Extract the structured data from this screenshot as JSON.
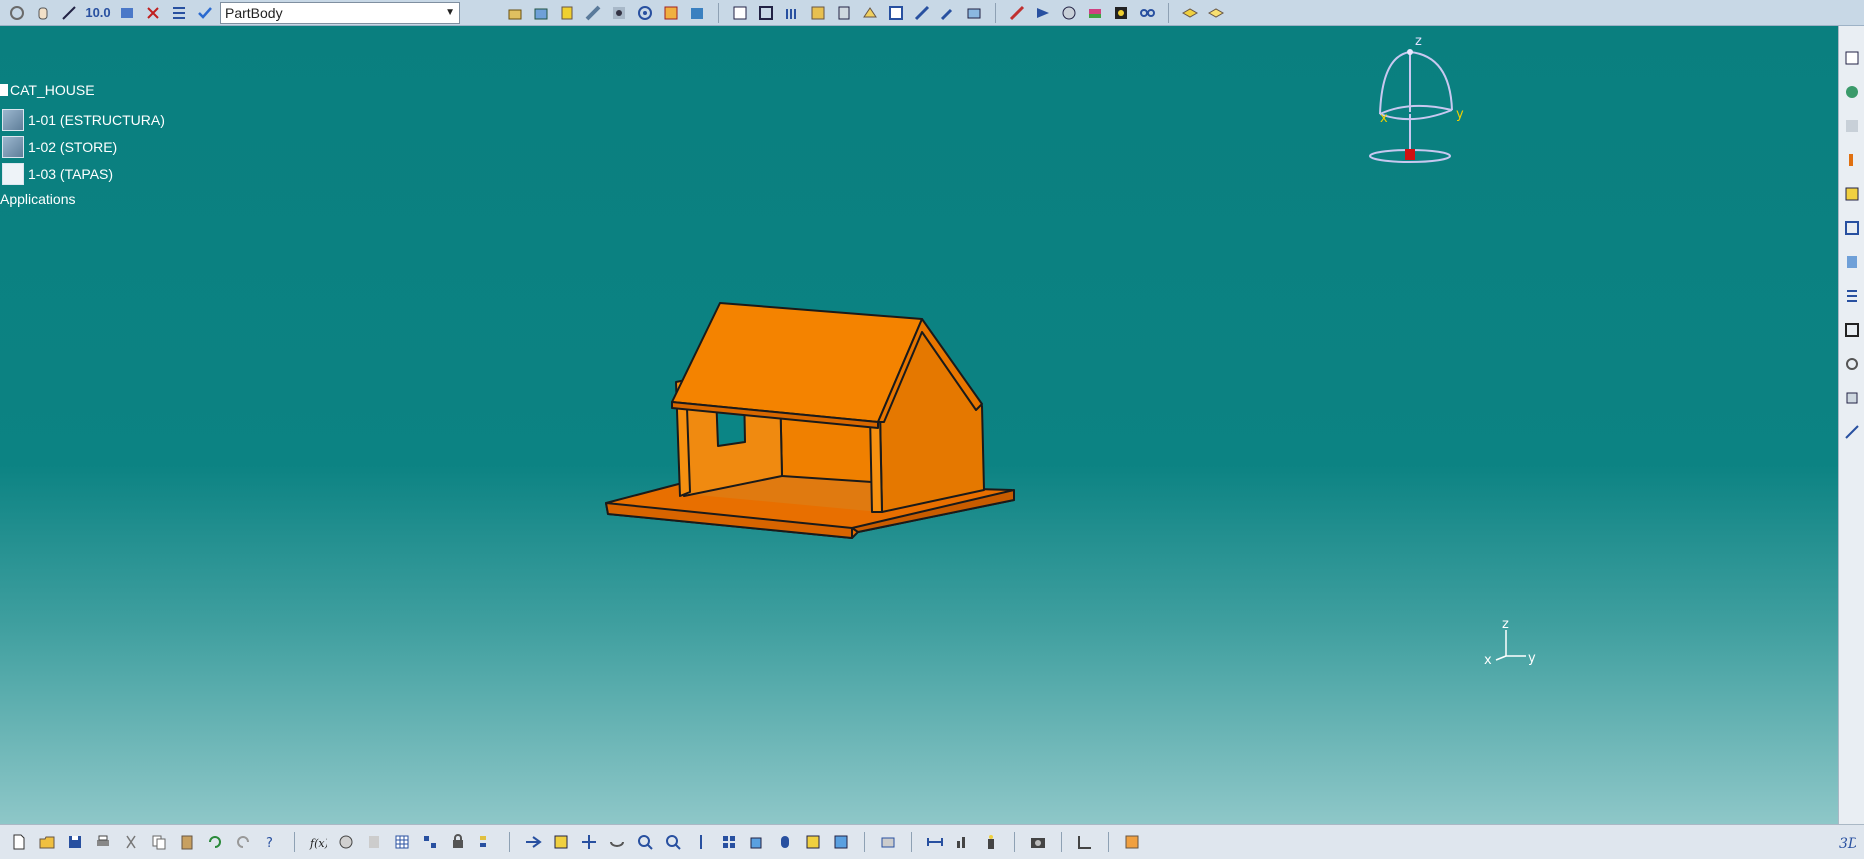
{
  "top_toolbar": {
    "precision_value": "10.0",
    "current_body": "PartBody",
    "icons": [
      "rotate-icon",
      "hand-icon",
      "measure-icon",
      "view-mode-icon",
      "cut-icon",
      "tree-list-icon",
      "check-icon",
      "pad-icon",
      "pocket-icon",
      "shaft-icon",
      "rib-icon",
      "hole-icon",
      "target-icon",
      "boolean-icon",
      "draft-icon",
      "edit-sketch-icon",
      "box-icon",
      "fillet-icon",
      "chamfer-icon",
      "shell-icon",
      "thickness-icon",
      "thread-icon",
      "remove-face-icon",
      "translate-icon",
      "mirror-icon",
      "pattern-icon",
      "scale-icon",
      "measure-item-icon",
      "publish-icon",
      "analysis-icon",
      "apply-material-icon",
      "render-icon",
      "constraint-icon",
      "layer-icon",
      "filter-icon"
    ]
  },
  "tree": {
    "root": "CAT_HOUSE",
    "items": [
      {
        "label": "1-01 (ESTRUCTURA)"
      },
      {
        "label": "1-02 (STORE)"
      },
      {
        "label": "1-03 (TAPAS)"
      }
    ],
    "applications": "Applications"
  },
  "compass": {
    "x_label": "x",
    "y_label": "y",
    "z_label": "z"
  },
  "axis_indicator": {
    "x_label": "x",
    "y_label": "y",
    "z_label": "z"
  },
  "bottom_toolbar": {
    "icons": [
      "new-file-icon",
      "open-folder-icon",
      "save-icon",
      "print-icon",
      "cut-icon",
      "copy-icon",
      "paste-icon",
      "undo-icon",
      "redo-icon",
      "help-icon",
      "formula-icon",
      "knowledge-icon",
      "design-table-icon",
      "spreadsheet-icon",
      "catalog-icon",
      "macro-icon",
      "tree-expand-icon",
      "fly-mode-icon",
      "fit-all-icon",
      "pan-icon",
      "rotate-view-icon",
      "zoom-in-icon",
      "zoom-out-icon",
      "normal-view-icon",
      "multi-view-icon",
      "isometric-view-icon",
      "shading-icon",
      "hide-show-icon",
      "swap-visible-icon",
      "snapshot-icon",
      "dimension-icon",
      "graph-icon",
      "lamp-icon",
      "camera-icon",
      "chart-icon",
      "plugin-icon",
      "3d-logo-icon"
    ]
  },
  "right_toolbar": {
    "icons": [
      "toolbar-icon-1",
      "toolbar-icon-2",
      "toolbar-icon-3",
      "toolbar-icon-4",
      "toolbar-icon-5",
      "toolbar-icon-6",
      "toolbar-icon-7",
      "toolbar-icon-8",
      "toolbar-icon-9",
      "toolbar-icon-10",
      "toolbar-icon-11",
      "toolbar-icon-12"
    ]
  },
  "colors": {
    "background_top": "#0a7f7f",
    "background_bottom": "#8ec7c8",
    "model": "#f07d00"
  }
}
